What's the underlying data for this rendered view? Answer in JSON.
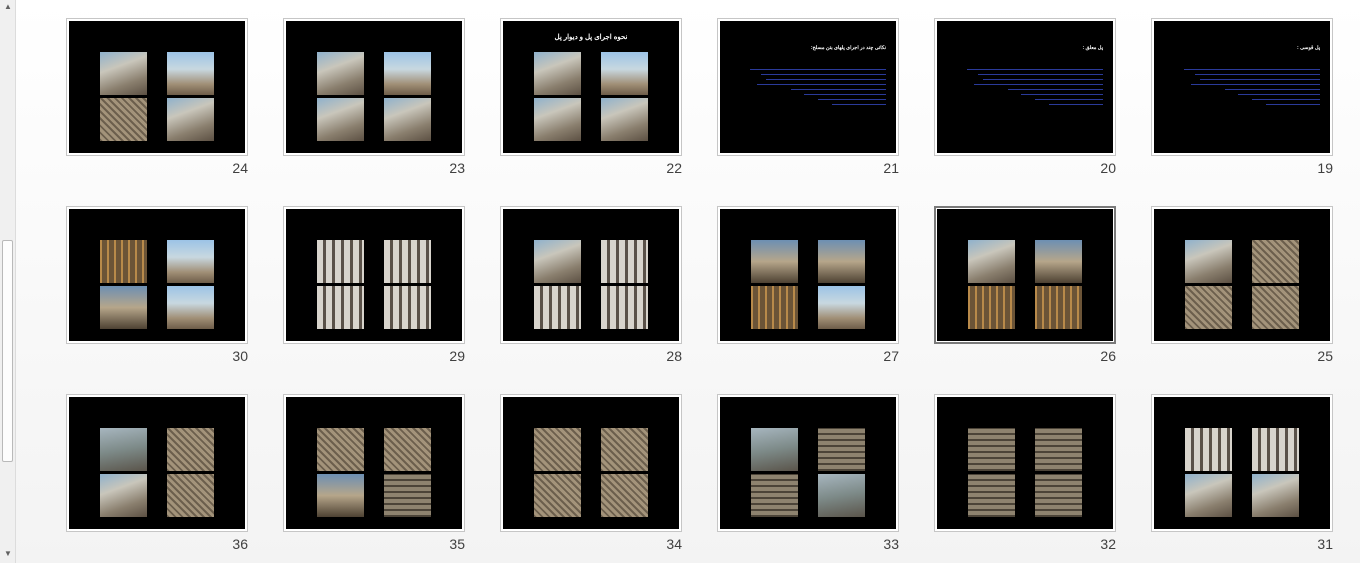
{
  "scrollbar": {
    "up_arrow": "up-arrow-icon",
    "down_arrow": "down-arrow-icon"
  },
  "slides": [
    {
      "number": "24",
      "layout": "photos",
      "photos": [
        "concrete",
        "sky",
        "rebar",
        "concrete"
      ]
    },
    {
      "number": "23",
      "layout": "photos",
      "photos": [
        "concrete",
        "sky",
        "concrete",
        "concrete"
      ]
    },
    {
      "number": "22",
      "layout": "titled-photos",
      "title": "نحوه اجرای پل و دیوار پل",
      "photos": [
        "concrete",
        "sky",
        "concrete",
        "concrete"
      ]
    },
    {
      "number": "21",
      "layout": "text",
      "title": "نکاتی چند در اجرای پلهای بتن مسلح:"
    },
    {
      "number": "20",
      "layout": "text",
      "title": "پل معلق :"
    },
    {
      "number": "19",
      "layout": "text",
      "title": "پل قوسی :"
    },
    {
      "number": "30",
      "layout": "photos",
      "photos": [
        "scaffold",
        "sky",
        "dusk",
        "sky"
      ]
    },
    {
      "number": "29",
      "layout": "photos",
      "photos": [
        "beams",
        "beams",
        "beams",
        "beams"
      ]
    },
    {
      "number": "28",
      "layout": "photos",
      "photos": [
        "concrete",
        "beams",
        "beams",
        "beams"
      ]
    },
    {
      "number": "27",
      "layout": "photos",
      "photos": [
        "dusk",
        "dusk",
        "scaffold",
        "sky"
      ]
    },
    {
      "number": "26",
      "layout": "photos",
      "selected": true,
      "photos": [
        "concrete",
        "dusk",
        "scaffold",
        "scaffold"
      ]
    },
    {
      "number": "25",
      "layout": "photos",
      "photos": [
        "concrete",
        "rebar",
        "rebar",
        "rebar"
      ]
    },
    {
      "number": "36",
      "layout": "photos",
      "photos": [
        "water",
        "rebar",
        "concrete",
        "rebar"
      ]
    },
    {
      "number": "35",
      "layout": "photos",
      "photos": [
        "rebar",
        "rebar",
        "dusk",
        "grid"
      ]
    },
    {
      "number": "34",
      "layout": "photos",
      "photos": [
        "rebar",
        "rebar",
        "rebar",
        "rebar"
      ]
    },
    {
      "number": "33",
      "layout": "photos",
      "photos": [
        "water",
        "grid",
        "grid",
        "water"
      ]
    },
    {
      "number": "32",
      "layout": "photos",
      "photos": [
        "grid",
        "grid",
        "grid",
        "grid"
      ]
    },
    {
      "number": "31",
      "layout": "photos",
      "photos": [
        "beams",
        "beams",
        "concrete",
        "concrete"
      ]
    }
  ]
}
